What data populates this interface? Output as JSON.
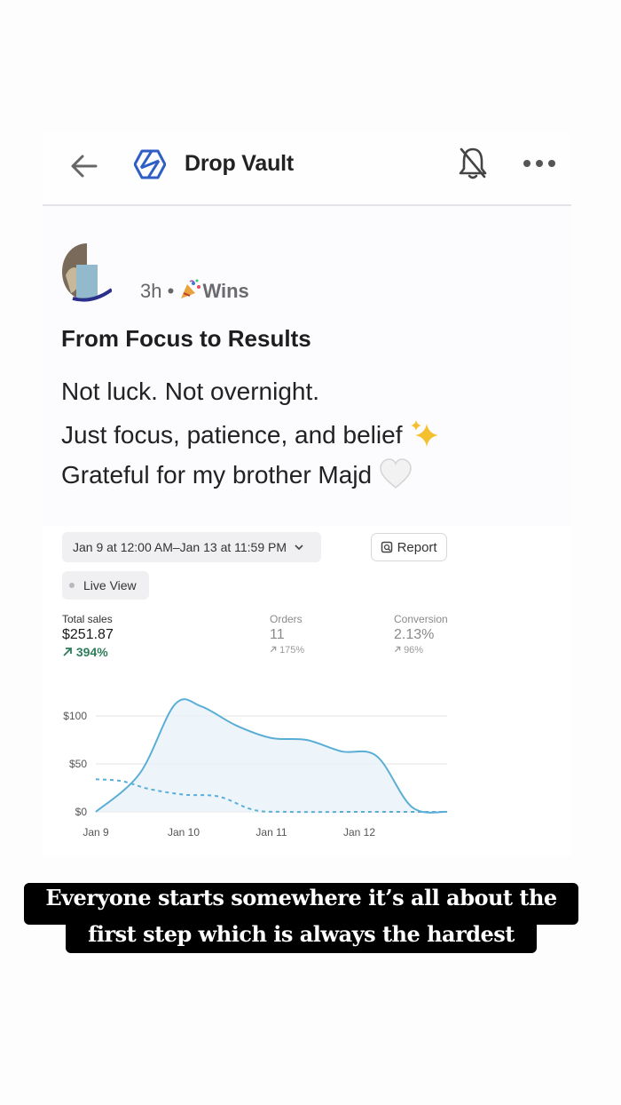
{
  "header": {
    "title": "Drop Vault"
  },
  "post": {
    "time": "3h",
    "separator": "•",
    "category": "Wins",
    "title": "From Focus to Results",
    "lines": [
      "Not luck. Not overnight.",
      "Just focus, patience, and belief",
      "Grateful for my brother Majd"
    ]
  },
  "analytics": {
    "date_range": "Jan 9 at 12:00 AM–Jan 13 at 11:59 PM",
    "report_label": "Report",
    "live_label": "Live View",
    "metrics": {
      "sales": {
        "label": "Total sales",
        "value": "$251.87",
        "delta": "394%"
      },
      "orders": {
        "label": "Orders",
        "value": "11",
        "delta": "175%"
      },
      "conversion": {
        "label": "Conversion",
        "value": "2.13%",
        "delta": "96%"
      }
    }
  },
  "chart_data": {
    "type": "area",
    "categories": [
      "Jan 9",
      "Jan 10",
      "Jan 11",
      "Jan 12"
    ],
    "y_ticks": [
      "$0",
      "$50",
      "$100"
    ],
    "ylim": [
      0,
      120
    ],
    "series": [
      {
        "style": "solid",
        "color": "#5aaed6",
        "x": [
          0,
          0.5,
          0.9,
          1.2,
          1.6,
          2.0,
          2.4,
          2.8,
          3.2,
          3.6,
          4.0
        ],
        "values": [
          0,
          40,
          112,
          110,
          90,
          77,
          75,
          63,
          58,
          5,
          0
        ]
      },
      {
        "style": "dashed",
        "color": "#5aaed6",
        "x": [
          0,
          0.3,
          0.6,
          1.0,
          1.4,
          1.8,
          2.2,
          3.0,
          4.0
        ],
        "values": [
          34,
          32,
          24,
          18,
          16,
          2,
          0,
          0,
          0
        ]
      }
    ]
  },
  "caption": {
    "line1": "Everyone starts somewhere it’s all about the",
    "line2": "first step which is always the hardest"
  },
  "colors": {
    "accent": "#2f5ec4",
    "positive": "#2e7d5b",
    "line": "#5aaed6",
    "caption_bg": "#000000"
  }
}
